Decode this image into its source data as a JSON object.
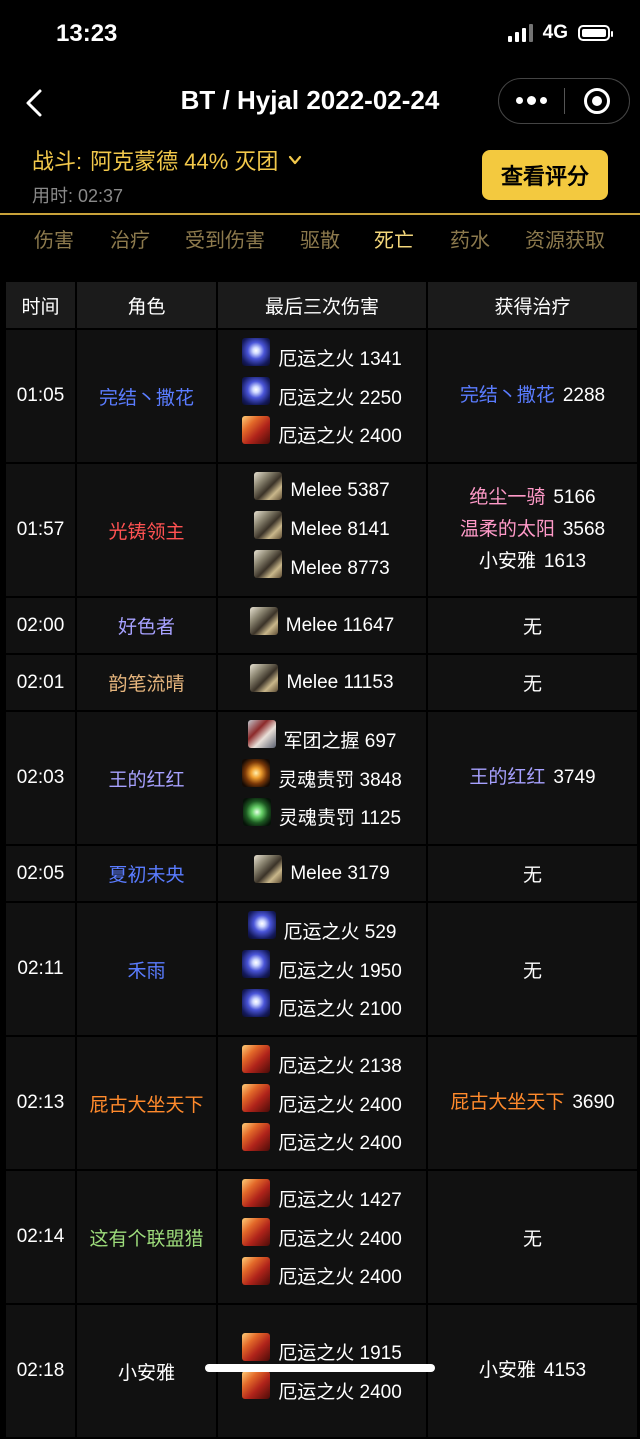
{
  "status_bar": {
    "time": "13:23",
    "network": "4G"
  },
  "nav": {
    "title": "BT / Hyjal 2022-02-24"
  },
  "fight": {
    "label": "战斗:",
    "boss": "阿克蒙德 44% 灭团",
    "duration": "用时: 02:37",
    "rate_button": "查看评分"
  },
  "tabs": [
    {
      "label": "伤害",
      "active": false
    },
    {
      "label": "治疗",
      "active": false
    },
    {
      "label": "受到伤害",
      "active": false
    },
    {
      "label": "驱散",
      "active": false
    },
    {
      "label": "死亡",
      "active": true
    },
    {
      "label": "药水",
      "active": false
    },
    {
      "label": "资源获取",
      "active": false
    }
  ],
  "table": {
    "headers": [
      "时间",
      "角色",
      "最后三次伤害",
      "获得治疗"
    ],
    "rows": [
      {
        "time": "01:05",
        "role": "完结丶撒花",
        "role_color": "#5a7cff",
        "hits": [
          {
            "icon": "doom-icon",
            "text": "厄运之火 1341"
          },
          {
            "icon": "doom-icon",
            "text": "厄运之火 2250"
          },
          {
            "icon": "fire-icon",
            "text": "厄运之火 2400"
          }
        ],
        "heals": [
          {
            "name": "完结丶撒花",
            "amount": "2288",
            "color": "#5a7cff"
          }
        ]
      },
      {
        "time": "01:57",
        "role": "光铸领主",
        "role_color": "#ff5252",
        "hits": [
          {
            "icon": "melee-icon",
            "text": "Melee 5387"
          },
          {
            "icon": "melee-icon",
            "text": "Melee 8141"
          },
          {
            "icon": "melee-icon",
            "text": "Melee 8773"
          }
        ],
        "heals": [
          {
            "name": "绝尘一骑",
            "amount": "5166",
            "color": "#ff9ac8"
          },
          {
            "name": "温柔的太阳",
            "amount": "3568",
            "color": "#ff9ac8"
          },
          {
            "name": "小安雅",
            "amount": "1613",
            "color": "#ffffff"
          }
        ]
      },
      {
        "time": "02:00",
        "role": "好色者",
        "role_color": "#a7a1ff",
        "hits": [
          {
            "icon": "melee-icon",
            "text": "Melee 11647"
          }
        ],
        "heals": [],
        "no_heal": "无"
      },
      {
        "time": "02:01",
        "role": "韵笔流晴",
        "role_color": "#e6b57d",
        "hits": [
          {
            "icon": "melee-icon",
            "text": "Melee 11153"
          }
        ],
        "heals": [],
        "no_heal": "无"
      },
      {
        "time": "02:03",
        "role": "王的红红",
        "role_color": "#a7a1ff",
        "hits": [
          {
            "icon": "legion-icon",
            "text": "军团之握 697"
          },
          {
            "icon": "soul-orange-icon",
            "text": "灵魂责罚 3848"
          },
          {
            "icon": "soul-green-icon",
            "text": "灵魂责罚 1125"
          }
        ],
        "heals": [
          {
            "name": "王的红红",
            "amount": "3749",
            "color": "#a7a1ff"
          }
        ]
      },
      {
        "time": "02:05",
        "role": "夏初未央",
        "role_color": "#5a7cff",
        "hits": [
          {
            "icon": "melee-icon",
            "text": "Melee 3179"
          }
        ],
        "heals": [],
        "no_heal": "无"
      },
      {
        "time": "02:11",
        "role": "禾雨",
        "role_color": "#5a7cff",
        "hits": [
          {
            "icon": "doom-icon",
            "text": "厄运之火 529"
          },
          {
            "icon": "doom-icon",
            "text": "厄运之火 1950"
          },
          {
            "icon": "doom-icon",
            "text": "厄运之火 2100"
          }
        ],
        "heals": [],
        "no_heal": "无"
      },
      {
        "time": "02:13",
        "role": "屁古大坐天下",
        "role_color": "#ff8a2c",
        "hits": [
          {
            "icon": "fire-icon",
            "text": "厄运之火 2138"
          },
          {
            "icon": "fire-icon",
            "text": "厄运之火 2400"
          },
          {
            "icon": "fire-icon",
            "text": "厄运之火 2400"
          }
        ],
        "heals": [
          {
            "name": "屁古大坐天下",
            "amount": "3690",
            "color": "#ff8a2c"
          }
        ]
      },
      {
        "time": "02:14",
        "role": "这有个联盟猎",
        "role_color": "#9ddc7b",
        "hits": [
          {
            "icon": "fire-icon",
            "text": "厄运之火 1427"
          },
          {
            "icon": "fire-icon",
            "text": "厄运之火 2400"
          },
          {
            "icon": "fire-icon",
            "text": "厄运之火 2400"
          }
        ],
        "heals": [],
        "no_heal": "无"
      },
      {
        "time": "02:18",
        "role": "小安雅",
        "role_color": "#ffffff",
        "hits": [
          {
            "icon": "fire-icon",
            "text": "厄运之火 1915"
          },
          {
            "icon": "fire-icon",
            "text": "厄运之火 2400"
          }
        ],
        "heals": [
          {
            "name": "小安雅",
            "amount": "4153",
            "color": "#ffffff"
          }
        ]
      }
    ]
  }
}
